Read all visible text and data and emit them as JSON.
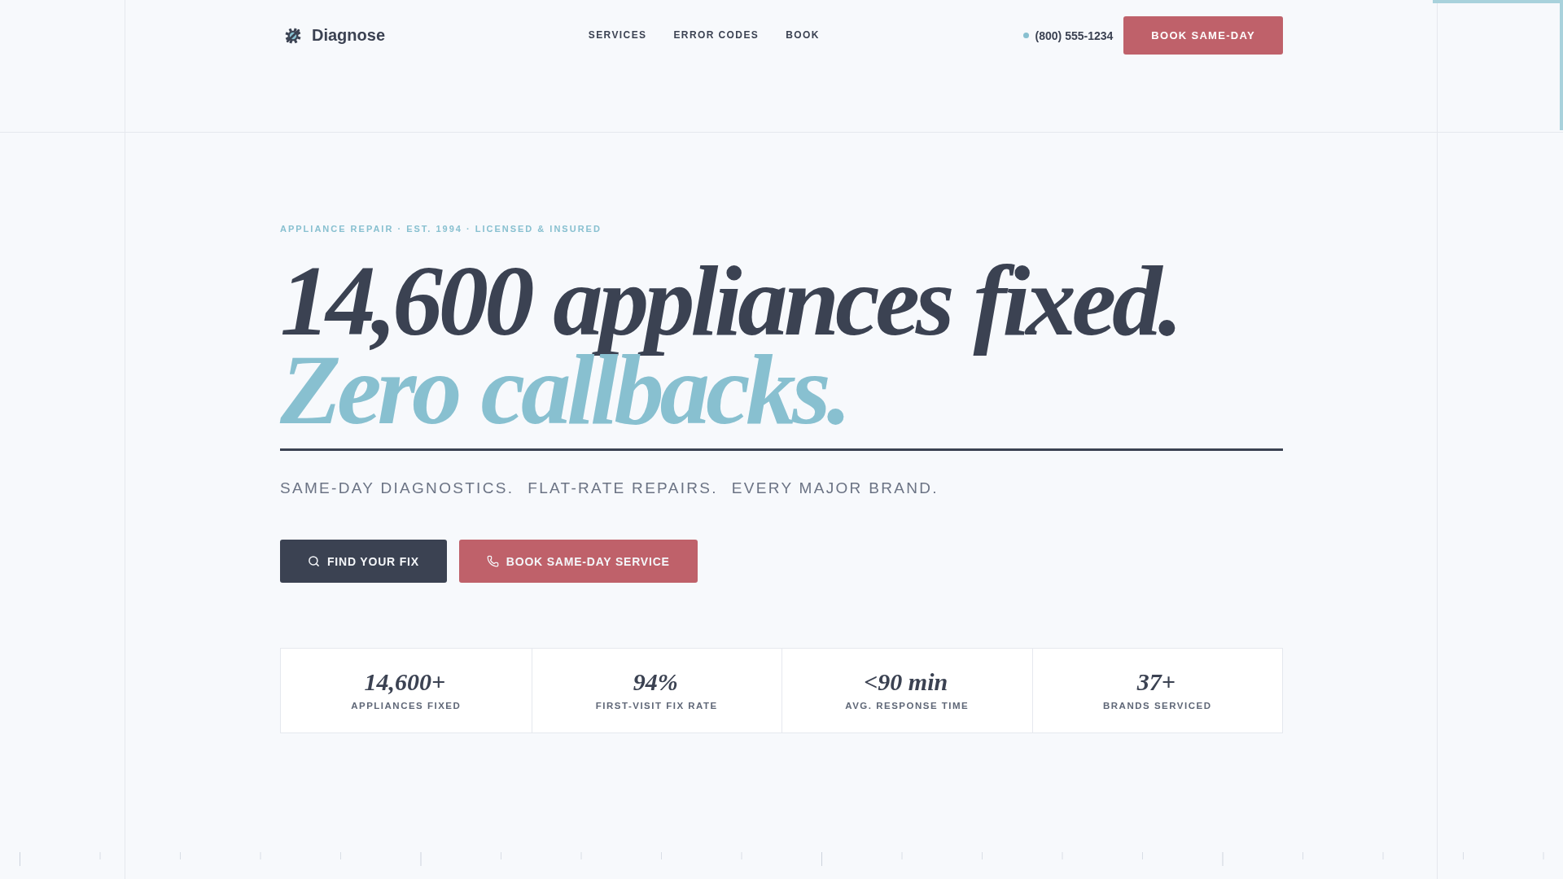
{
  "header": {
    "logo": {
      "name": "Diagnose"
    },
    "nav": [
      {
        "label": "SERVICES"
      },
      {
        "label": "ERROR CODES"
      },
      {
        "label": "BOOK"
      }
    ],
    "phone": "(800) 555-1234",
    "cta": "BOOK SAME-DAY"
  },
  "hero": {
    "eyebrow": "APPLIANCE REPAIR · EST. 1994 · LICENSED & INSURED",
    "headline": [
      {
        "text": "14,600 appliances fixed.",
        "accent": false
      },
      {
        "text": "Zero callbacks.",
        "accent": true
      }
    ],
    "taglines": [
      "SAME-DAY DIAGNOSTICS.",
      "FLAT-RATE REPAIRS.",
      "EVERY MAJOR BRAND."
    ],
    "buttons": [
      {
        "label": "FIND YOUR FIX",
        "kind": "primary"
      },
      {
        "label": "BOOK SAME-DAY SERVICE",
        "kind": "secondary"
      }
    ]
  },
  "stats": [
    {
      "value": "14,600+",
      "label": "APPLIANCES FIXED"
    },
    {
      "value": "94%",
      "label": "FIRST-VISIT FIX RATE"
    },
    {
      "value": "<90 min",
      "label": "AVG. RESPONSE TIME"
    },
    {
      "value": "37+",
      "label": "BRANDS SERVICED"
    }
  ]
}
